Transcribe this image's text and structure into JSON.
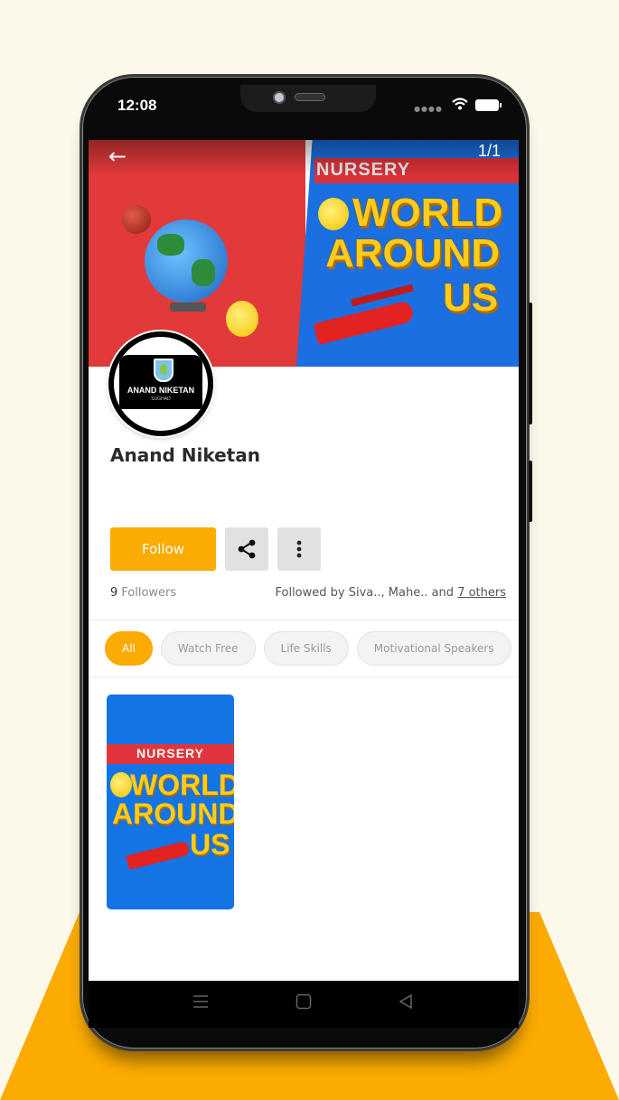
{
  "status_bar": {
    "time": "12:08",
    "signal_icon": "signal-dots-icon",
    "wifi_icon": "wifi-icon",
    "battery_icon": "battery-icon"
  },
  "banner": {
    "back_icon": "arrow-left-icon",
    "back_glyph": "←",
    "page_indicator": "1/1",
    "image_label": "NURSERY",
    "image_title_lines": [
      "WORLD",
      "AROUND",
      "US"
    ]
  },
  "profile": {
    "avatar_name": "ANAND NIKETAN",
    "avatar_subtitle": "SUGHAD",
    "name": "Anand Niketan"
  },
  "actions": {
    "follow_label": "Follow",
    "share_icon": "share-icon",
    "more_icon": "more-vertical-icon"
  },
  "followers": {
    "count": "9",
    "label": "Followers",
    "followed_by_prefix": "Followed by Siva.., Mahe.. and ",
    "others_link": "7 others"
  },
  "filters": {
    "chips": [
      {
        "label": "All",
        "active": true
      },
      {
        "label": "Watch Free",
        "active": false
      },
      {
        "label": "Life Skills",
        "active": false
      },
      {
        "label": "Motivational Speakers",
        "active": false
      },
      {
        "label": "",
        "active": false
      }
    ]
  },
  "content": {
    "cards": [
      {
        "label": "NURSERY",
        "title_lines": [
          "WORLD",
          "AROUND",
          "US"
        ]
      }
    ]
  },
  "nav_bar": {
    "menu_icon": "menu-icon",
    "home_icon": "home-square-icon",
    "back_icon": "back-triangle-icon"
  },
  "colors": {
    "accent": "#fbab02",
    "background": "#fdf9ea",
    "chip_inactive": "#f3f3f3",
    "banner_blue": "#1b6fe0",
    "banner_red": "#e23a3a"
  }
}
